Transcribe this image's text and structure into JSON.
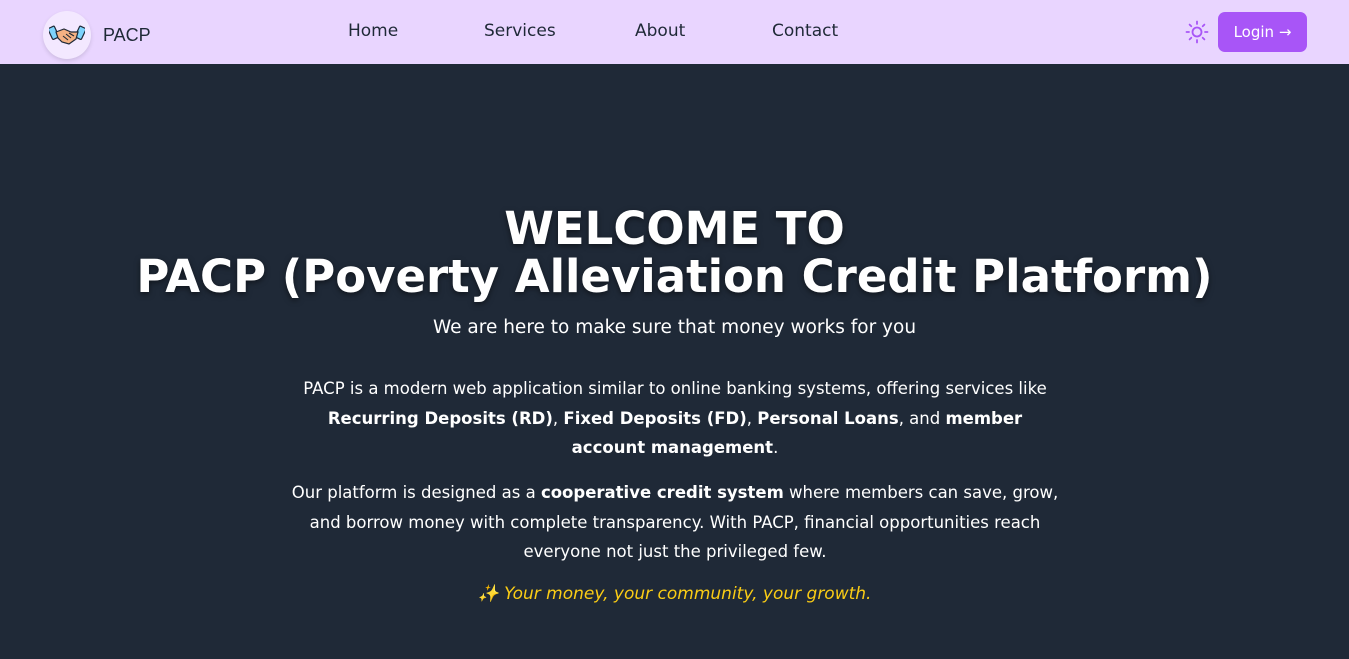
{
  "nav": {
    "brand": "PACP",
    "links": [
      "Home",
      "Services",
      "About",
      "Contact"
    ],
    "login_label": "Login →"
  },
  "hero": {
    "title_line1": "WELCOME TO",
    "title_line2": "PACP (Poverty Alleviation Credit Platform)",
    "subtitle": "We are here to make sure that money works for you",
    "p1": {
      "intro": "PACP is a modern web application similar to online banking systems, offering services like ",
      "rd": "Recurring Deposits (RD)",
      "sep1": ", ",
      "fd": "Fixed Deposits (FD)",
      "sep2": ", ",
      "loans": "Personal Loans",
      "sep3": ", and ",
      "mgmt": "member account management",
      "end": "."
    },
    "p2": {
      "intro": "Our platform is designed as a ",
      "bold": "cooperative credit system",
      "rest": " where members can save, grow, and borrow money with complete transparency. With PACP, financial opportunities reach everyone not just the privileged few."
    },
    "tagline": "✨ Your money, your community, your growth."
  },
  "colors": {
    "nav_bg": "#e9d5ff",
    "page_bg": "#1f2937",
    "accent": "#a855f7",
    "tagline": "#facc15"
  },
  "icons": {
    "logo": "handshake-icon",
    "theme": "sun-icon"
  }
}
